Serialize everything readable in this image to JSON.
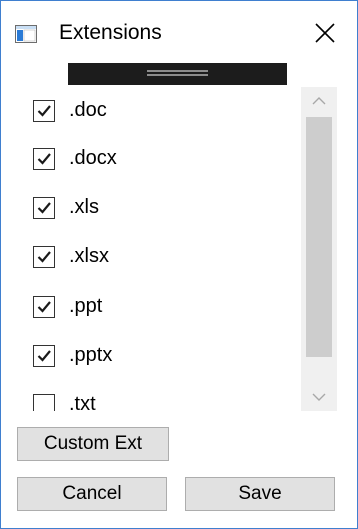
{
  "window": {
    "title": "Extensions",
    "icons": {
      "app": "window-app-icon",
      "close": "close-icon"
    }
  },
  "extensions": {
    "items": [
      {
        "label": ".doc",
        "checked": true
      },
      {
        "label": ".docx",
        "checked": true
      },
      {
        "label": ".xls",
        "checked": true
      },
      {
        "label": ".xlsx",
        "checked": true
      },
      {
        "label": ".ppt",
        "checked": true
      },
      {
        "label": ".pptx",
        "checked": true
      },
      {
        "label": ".txt",
        "checked": false
      }
    ]
  },
  "scrollbar": {
    "icons": {
      "up": "chevron-up-icon",
      "down": "chevron-down-icon"
    }
  },
  "buttons": {
    "custom_ext": "Custom Ext",
    "cancel": "Cancel",
    "save": "Save"
  },
  "colors": {
    "window_border": "#3f7fcf",
    "drag_handle": "#1c1c1c",
    "scroll_thumb": "#cdcdcd",
    "button_face": "#e1e1e1"
  }
}
